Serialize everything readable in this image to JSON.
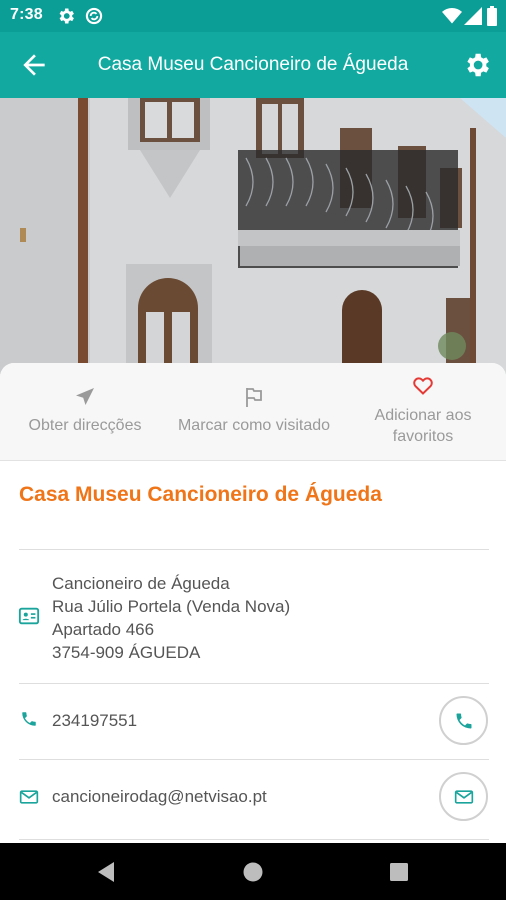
{
  "status_bar": {
    "time": "7:38",
    "icons": [
      "gear-icon",
      "sync-icon",
      "wifi-icon",
      "signal-icon",
      "battery-icon"
    ]
  },
  "app_bar": {
    "title": "Casa Museu Cancioneiro de Águeda",
    "icons": [
      "back-arrow-icon",
      "settings-icon"
    ]
  },
  "actions": [
    {
      "label": "Obter direcções",
      "icon": "navigation-arrow-icon"
    },
    {
      "label": "Marcar como visitado",
      "icon": "flag-icon"
    },
    {
      "label": "Adicionar aos favoritos",
      "icon": "heart-icon"
    }
  ],
  "place": {
    "title": "Casa Museu Cancioneiro de Águeda",
    "address_lines": [
      "Cancioneiro de Águeda",
      "Rua Júlio Portela (Venda Nova)",
      "Apartado 466",
      "3754-909 ÁGUEDA"
    ],
    "phone": "234197551",
    "email": "cancioneirodag@netvisao.pt"
  },
  "colors": {
    "accent": "#12aaa0",
    "status_bar": "#0b9e97",
    "title_orange": "#f07518",
    "favorite_red": "#e53935",
    "icon_teal": "#1aa49b"
  },
  "nav_bar": {
    "icons": [
      "back-triangle-icon",
      "home-circle-icon",
      "recents-square-icon"
    ]
  }
}
